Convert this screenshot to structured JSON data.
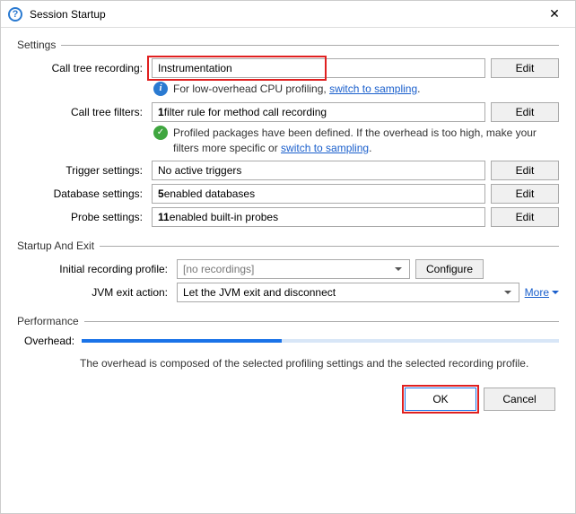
{
  "window": {
    "title": "Session Startup"
  },
  "settings": {
    "heading": "Settings",
    "callTreeRecording": {
      "label": "Call tree recording:",
      "value": "Instrumentation",
      "edit": "Edit"
    },
    "recordingHint": {
      "pre": "For low-overhead CPU profiling, ",
      "link": "switch to sampling",
      "post": "."
    },
    "callTreeFilters": {
      "label": "Call tree filters:",
      "bold": "1",
      "rest": " filter rule for method call recording",
      "edit": "Edit"
    },
    "filtersHint": {
      "pre": "Profiled packages have been defined. If the overhead is too high, make your filters more specific or ",
      "link": "switch to sampling",
      "post": "."
    },
    "triggerSettings": {
      "label": "Trigger settings:",
      "value": "No active triggers",
      "edit": "Edit"
    },
    "databaseSettings": {
      "label": "Database settings:",
      "bold": "5",
      "rest": " enabled databases",
      "edit": "Edit"
    },
    "probeSettings": {
      "label": "Probe settings:",
      "bold": "11",
      "rest": " enabled built-in probes",
      "edit": "Edit"
    }
  },
  "startupExit": {
    "heading": "Startup And Exit",
    "initialProfile": {
      "label": "Initial recording profile:",
      "selected": "[no recordings]",
      "configure": "Configure"
    },
    "jvmExit": {
      "label": "JVM exit action:",
      "selected": "Let the JVM exit and disconnect",
      "more": "More"
    }
  },
  "performance": {
    "heading": "Performance",
    "overheadLabel": "Overhead:",
    "overheadPercent": 42,
    "note": "The overhead is composed of the selected profiling settings and the selected recording profile."
  },
  "footer": {
    "ok": "OK",
    "cancel": "Cancel"
  }
}
